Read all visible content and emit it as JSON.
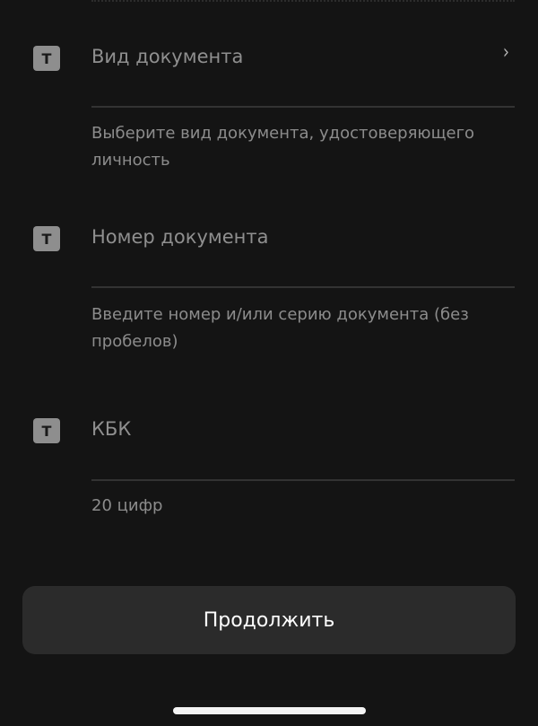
{
  "fields": [
    {
      "icon_letter": "T",
      "icon": "text-field-icon",
      "label": "Вид документа",
      "hint": "Выберите вид документа, удостоверяющего личность",
      "has_chevron": true,
      "chevron_icon": "chevron-right-icon"
    },
    {
      "icon_letter": "T",
      "icon": "text-field-icon",
      "label": "Номер документа",
      "hint": "Введите номер и/или серию документа (без пробелов)"
    },
    {
      "icon_letter": "T",
      "icon": "text-field-icon",
      "label": "КБК",
      "hint": "20 цифр"
    }
  ],
  "chevron_glyph": "›",
  "continue_button": {
    "label": "Продолжить"
  },
  "colors": {
    "background": "#141414",
    "button_background": "#2b2b2b",
    "button_text": "#ffffff",
    "label_text": "#8f8f8f",
    "icon_badge": "#8e8e8e"
  }
}
